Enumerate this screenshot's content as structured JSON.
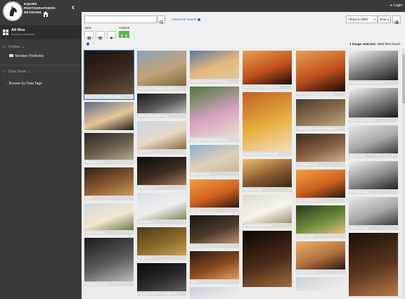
{
  "brand": {
    "line1": "EQUINE",
    "line2": "PHOTOGRAPHERS",
    "line3": "NETWORK"
  },
  "sidebar": {
    "all_files": {
      "title": "All files",
      "subtitle": "Search in all photos"
    },
    "folders_label": "Folders",
    "folders_items": [
      {
        "label": "Member Portfolios"
      }
    ],
    "data_views_label": "Data Views",
    "data_views_items": [
      {
        "label": "Browse by Data Tags"
      }
    ]
  },
  "topbar": {
    "login_label": "Login"
  },
  "toolbar": {
    "search": {
      "value": "",
      "placeholder": ""
    },
    "advanced_search": "Advanced search",
    "sort_field": "Added to DBG",
    "sort_order": "Desc",
    "view_label": "View",
    "actions_label": "Actions",
    "status": {
      "selected": "1 image selected.",
      "count": "3965 files found."
    }
  },
  "gallery": {
    "columns": [
      [
        {
          "caption": "PBurchett_20190911_8739",
          "img": "horse-dark",
          "h": 62,
          "selected": true
        },
        {
          "caption": "",
          "img": "cowboy-sunset",
          "h": 40
        },
        {
          "caption": "Morning Dace",
          "img": "barn",
          "h": 38
        },
        {
          "caption": "Callie",
          "img": "horse-brown",
          "h": 40
        },
        {
          "caption": "Blonde Beauty",
          "img": "woman-horse",
          "h": 38
        },
        {
          "caption": "Seething Beauty",
          "img": "horse-bw",
          "h": 62
        }
      ],
      [
        {
          "caption": "20141004_PBurchett_0063",
          "img": "riders-field",
          "h": 50
        },
        {
          "caption": "Storm Horse Head.jpg",
          "img": "horse-bw",
          "h": 28
        },
        {
          "caption": "I love you!",
          "img": "girl-pony",
          "h": 40
        },
        {
          "caption": "Full of Love",
          "img": "hug-dark",
          "h": 40
        },
        {
          "caption": "Windblown",
          "img": "white-horse",
          "h": 38
        },
        {
          "caption": "Hide Place",
          "img": "horse-trees",
          "h": 40
        },
        {
          "caption": "Dreamy Down the Hill (black)",
          "img": "black-horse",
          "h": 40
        }
      ],
      [
        {
          "caption": "PBurchett_20150719_0026",
          "img": "beach-rider",
          "h": 40
        },
        {
          "caption": "PCSlipKnot-Cowgirl-Hat.jpg",
          "img": "woman-flowers",
          "h": 72
        },
        {
          "caption": "Beach Beauty",
          "img": "beach-girl",
          "h": 38
        },
        {
          "caption": "My Girl",
          "img": "sunset-horse",
          "h": 40
        },
        {
          "caption": "My Guy",
          "img": "woman-dark",
          "h": 40
        },
        {
          "caption": "Hug",
          "img": "hug-sunset",
          "h": 40
        },
        {
          "caption": "",
          "img": "sky",
          "h": 20
        }
      ],
      [
        {
          "caption": "20141004_PBurchett_0245",
          "img": "silhouette-sunset",
          "h": 48
        },
        {
          "caption": "LastScene-JoanDavis.jpg",
          "img": "autumn-rider",
          "h": 84
        },
        {
          "caption": "Morning Light",
          "img": "horse-field",
          "h": 40
        },
        {
          "caption": "Embrace the Moment",
          "img": "woman-white-horse",
          "h": 40
        },
        {
          "caption": "",
          "img": "horse-closeup",
          "h": 80
        }
      ],
      [
        {
          "caption": "20141004_PBurchett_0035",
          "img": "silhouette-sunset",
          "h": 58
        },
        {
          "caption": "Davis-Joan-HeardInTheBarn",
          "img": "horses-running",
          "h": 38
        },
        {
          "caption": "Unbridled Love",
          "img": "hug-brown",
          "h": 40
        },
        {
          "caption": "Feel the Breeze",
          "img": "sunset-horse",
          "h": 40
        },
        {
          "caption": "Up the Road",
          "img": "forest-rider",
          "h": 40
        },
        {
          "caption": "Keeping Watch",
          "img": "two-horses",
          "h": 40
        },
        {
          "caption": "",
          "img": "sky",
          "h": 20
        }
      ],
      [
        {
          "caption": "Sempervirens-Joan-Davis",
          "img": "bw-herd",
          "h": 42
        },
        {
          "caption": "March of the Mares",
          "img": "bw-herd",
          "h": 42
        },
        {
          "caption": "Beach Ride",
          "img": "bw-beach",
          "h": 40
        },
        {
          "caption": "Winning Smile",
          "img": "bw-rider",
          "h": 40
        },
        {
          "caption": "Walk this Way",
          "img": "bw-beach",
          "h": 40
        },
        {
          "caption": "",
          "img": "horse-brown-close",
          "h": 90
        }
      ]
    ]
  }
}
